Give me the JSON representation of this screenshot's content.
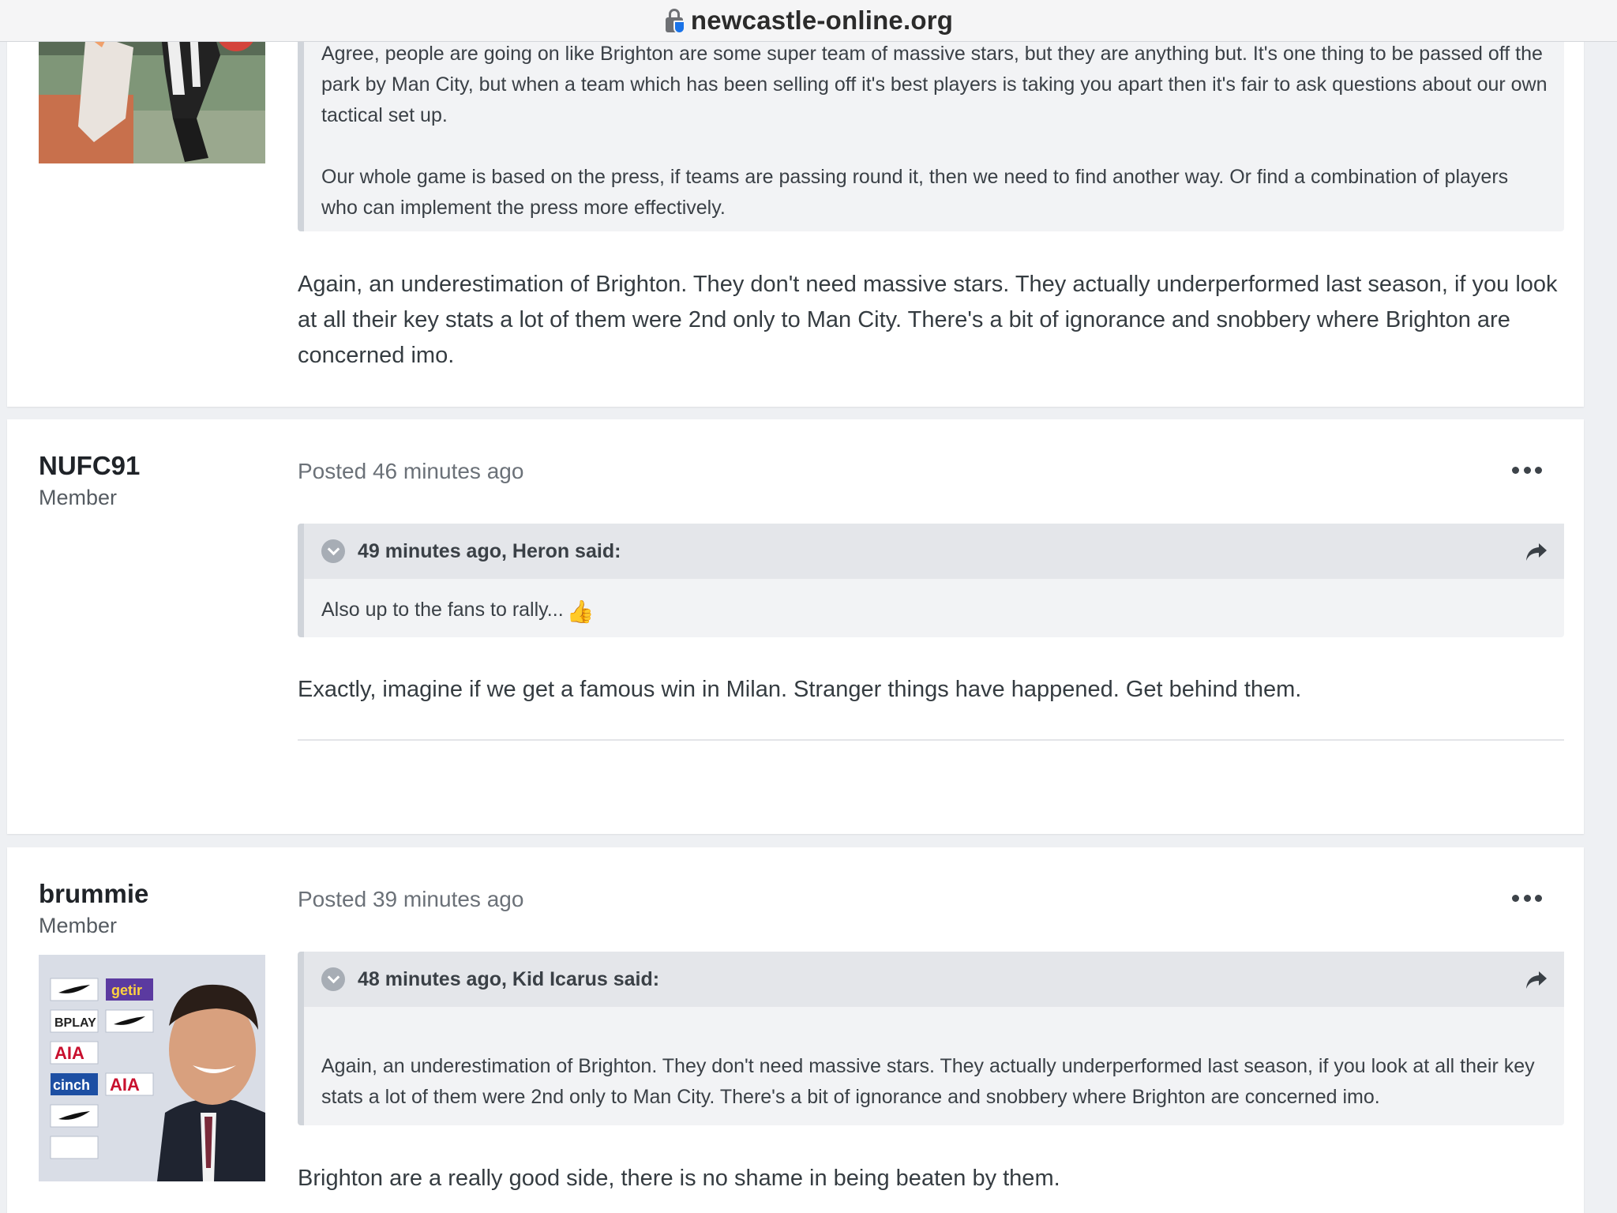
{
  "browser": {
    "domain": "newcastle-online.org"
  },
  "posts": [
    {
      "quote_paragraphs": [
        "Agree, people are going on like Brighton are some super team of massive stars, but they are anything but. It's one thing to be passed off the park by Man City, but when a team which has been selling off it's best players is taking you apart then it's fair to ask questions about our own tactical set up.",
        "Our whole game is based on the press, if teams are passing round it, then we need to find another way. Or find a combination of players who can implement the press more effectively."
      ],
      "text": "Again, an underestimation of Brighton. They don't need massive stars. They actually underperformed last season, if you look at all their key stats a lot of them were 2nd only to Man City. There's a bit of ignorance and snobbery where Brighton are concerned imo."
    },
    {
      "author": "NUFC91",
      "role": "Member",
      "posted": "Posted 46 minutes ago",
      "quote_cite": "49 minutes ago, Heron said:",
      "quote_text": "Also up to the fans to rally...",
      "quote_emoji": "👍",
      "text": "Exactly, imagine if we get a famous win in Milan. Stranger things have happened. Get behind them."
    },
    {
      "author": "brummie",
      "role": "Member",
      "posted": "Posted 39 minutes ago",
      "quote_cite": "48 minutes ago, Kid Icarus said:",
      "quote_text": "Again, an underestimation of Brighton. They don't need massive stars. They actually underperformed last season, if you look at all their key stats a lot of them were 2nd only to Man City. There's a bit of ignorance and snobbery where Brighton are concerned imo.",
      "text": "Brighton are a really good side, there is no shame in being beaten by them."
    }
  ],
  "sponsor_board": [
    "getir",
    "AIA",
    "BPLAY",
    "cinch",
    "AIA"
  ]
}
